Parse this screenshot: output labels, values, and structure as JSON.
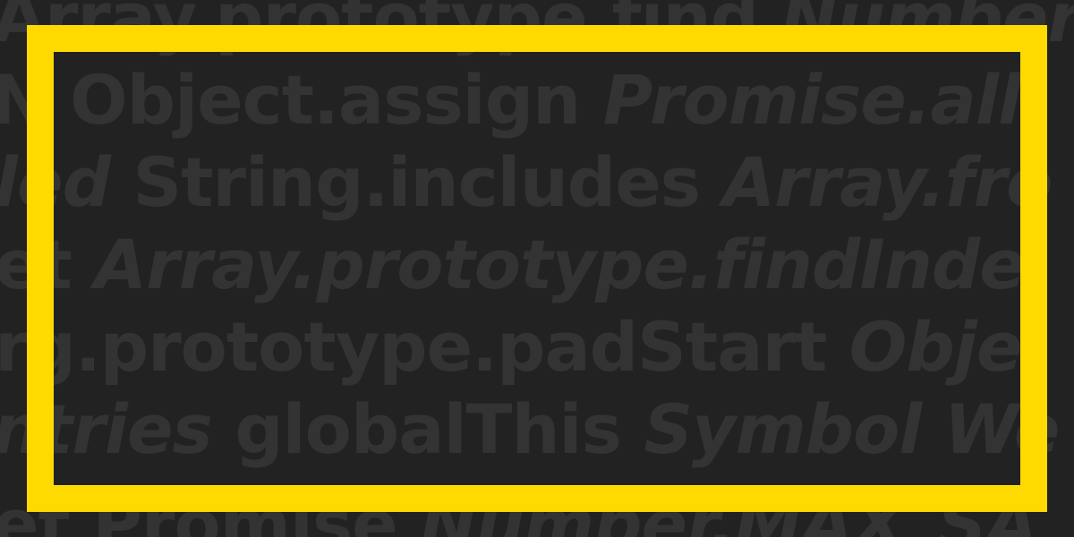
{
  "background": {
    "color": "#222222",
    "text_color": "#333333",
    "lines": [
      {
        "segments": [
          {
            "text": "Array.prototype.find ",
            "italic": false
          },
          {
            "text": "Number.i",
            "italic": true
          }
        ]
      },
      {
        "segments": [
          {
            "text": "N Object.assign ",
            "italic": false
          },
          {
            "text": "Promise.all",
            "italic": true
          }
        ]
      },
      {
        "segments": [
          {
            "text": "led",
            "italic": true
          },
          {
            "text": " String.includes ",
            "italic": false
          },
          {
            "text": "Array.fro",
            "italic": true
          }
        ]
      },
      {
        "segments": [
          {
            "text": "et ",
            "italic": false
          },
          {
            "text": "Array.prototype.findInde",
            "italic": true
          }
        ]
      },
      {
        "segments": [
          {
            "text": "rg.prototype.padStart ",
            "italic": false
          },
          {
            "text": "Obje",
            "italic": true
          }
        ]
      },
      {
        "segments": [
          {
            "text": "ntries",
            "italic": true
          },
          {
            "text": " globalThis ",
            "italic": false
          },
          {
            "text": "Symbol We",
            "italic": true
          }
        ]
      },
      {
        "segments": [
          {
            "text": "et Promise ",
            "italic": false
          },
          {
            "text": "Number.MAX_SA",
            "italic": true
          }
        ]
      }
    ]
  },
  "frame": {
    "color": "#FFDA00"
  }
}
